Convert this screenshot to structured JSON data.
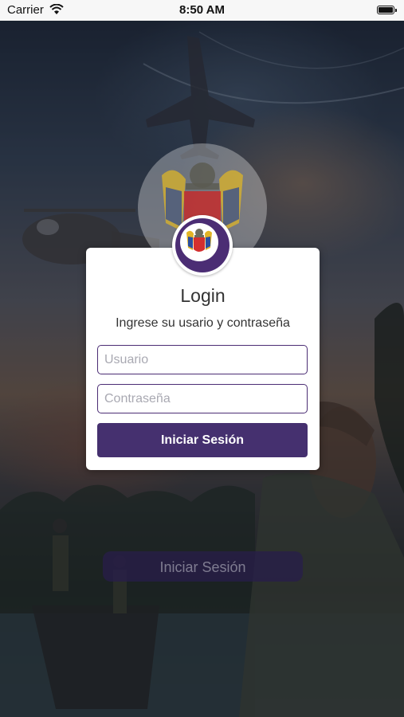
{
  "status_bar": {
    "carrier": "Carrier",
    "time": "8:50 AM",
    "battery_level": 1.0
  },
  "login_dialog": {
    "title": "Login",
    "subtitle": "Ingrese su usario y contraseña",
    "username_placeholder": "Usuario",
    "password_placeholder": "Contraseña",
    "submit_label": "Iniciar Sesión"
  },
  "background": {
    "button_label": "Iniciar Sesión"
  },
  "colors": {
    "accent": "#45306f",
    "badge_ring": "#4b2d74",
    "dialog": "#ffffff"
  }
}
